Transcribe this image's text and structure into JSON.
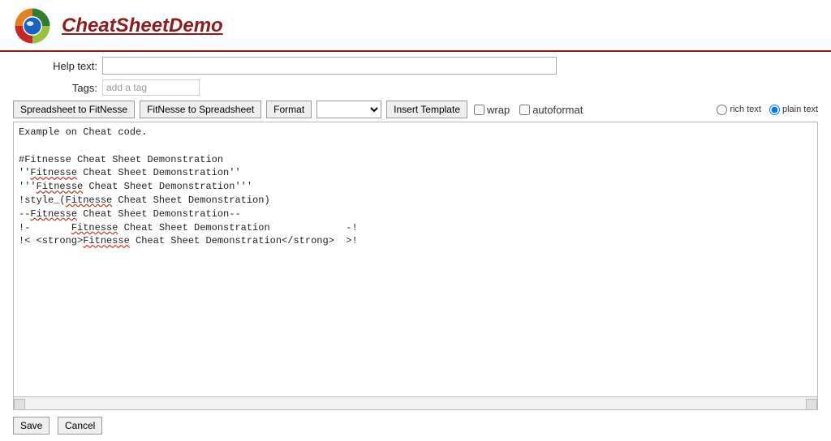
{
  "header": {
    "title": "CheatSheetDemo"
  },
  "fields": {
    "help_label": "Help text:",
    "help_value": "",
    "tags_label": "Tags:",
    "tags_placeholder": "add a tag",
    "tags_value": ""
  },
  "toolbar": {
    "btn_spreadsheet_to_fitnesse": "Spreadsheet to FitNesse",
    "btn_fitnesse_to_spreadsheet": "FitNesse to Spreadsheet",
    "btn_format": "Format",
    "template_selected": "",
    "btn_insert_template": "Insert Template",
    "wrap_label": "wrap",
    "wrap_checked": false,
    "autoformat_label": "autoformat",
    "autoformat_checked": false,
    "mode_richtext_label": "rich text",
    "mode_plaintext_label": "plain text",
    "mode_selected": "plain text"
  },
  "editor": {
    "spell_word": "Fitnesse",
    "lines": [
      "Example on Cheat code.",
      "",
      "#Fitnesse Cheat Sheet Demonstration",
      "''{SPELL} Cheat Sheet Demonstration''",
      "'''{SPELL} Cheat Sheet Demonstration'''",
      "!style_({SPELL} Cheat Sheet Demonstration)",
      "--{SPELL} Cheat Sheet Demonstration--",
      "!-       {SPELL} Cheat Sheet Demonstration             -!",
      "!< <strong>{SPELL} Cheat Sheet Demonstration</strong>  >!"
    ]
  },
  "footer": {
    "save_label": "Save",
    "cancel_label": "Cancel"
  }
}
